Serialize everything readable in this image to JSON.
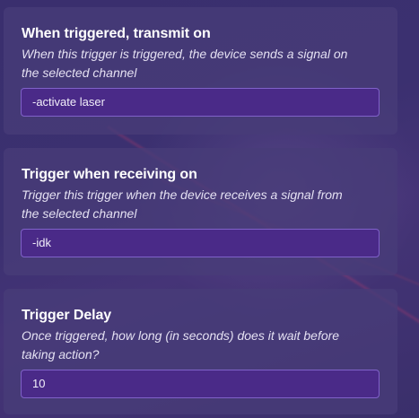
{
  "panels": [
    {
      "title": "When triggered, transmit on",
      "description": "When this trigger is triggered, the device sends a signal on the selected channel",
      "value": "-activate laser"
    },
    {
      "title": "Trigger when receiving on",
      "description": "Trigger this trigger when the device receives a signal from the selected channel",
      "value": "-idk"
    },
    {
      "title": "Trigger Delay",
      "description": "Once triggered, how long (in seconds) does it wait before taking action?",
      "value": "10"
    }
  ],
  "colors": {
    "background": "#3b3070",
    "panel": "#483c78",
    "field_bg": "#4a2a88",
    "field_border": "#8062c9",
    "title_text": "#ffffff",
    "desc_text": "#e4e0f2"
  }
}
